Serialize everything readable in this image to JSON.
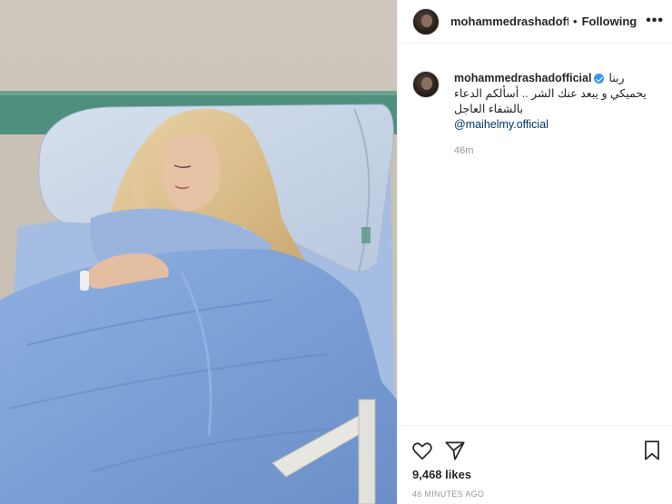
{
  "post": {
    "author": {
      "username": "mohammedrashadofficial",
      "username_truncated": "mohammedrashadoffic",
      "verified": true,
      "avatar_icon": "profile-avatar"
    },
    "header": {
      "separator": "•",
      "follow_label": "Following",
      "more_label": "•••"
    },
    "caption": {
      "line1": "ربنا",
      "line2": "يحميكي و يبعد عنك الشر .. أسألكم الدعاء",
      "line3": "بالشفاء العاجل",
      "mention": "@maihelmy.official",
      "time_ago": "46m"
    },
    "actions": {
      "like_icon": "heart-outline-icon",
      "share_icon": "paper-plane-icon",
      "save_icon": "bookmark-icon",
      "likes_text": "9,468 likes",
      "posted_text": "46 MINUTES AGO"
    },
    "colors": {
      "verified_badge": "#3897f0",
      "mention": "#003569",
      "muted": "#999999",
      "blanket": "#7fa2d6",
      "pillow": "#c7d4e6",
      "wall_stripe": "#4f8f7d"
    }
  }
}
